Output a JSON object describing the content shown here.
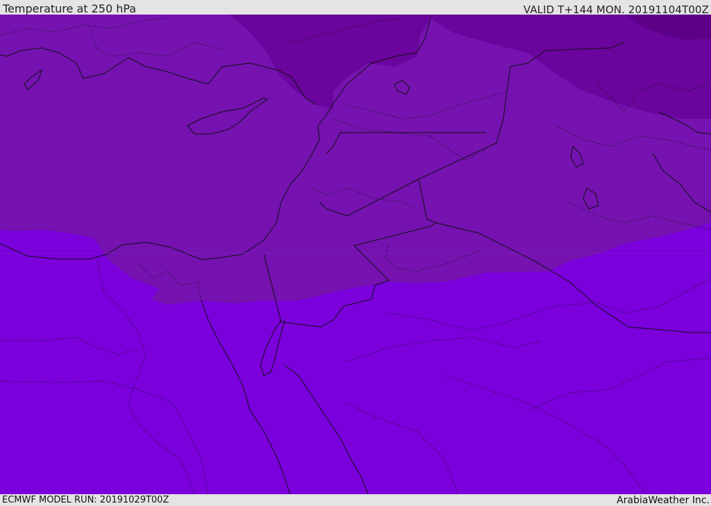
{
  "header": {
    "title": "Temperature at 250 hPa",
    "valid": "VALID T+144 MON. 20191104T00Z"
  },
  "footer": {
    "model_run": "ECMWF MODEL RUN: 20191029T00Z",
    "credit": "ArabiaWeather Inc."
  },
  "map": {
    "region": "Eastern Mediterranean / Middle East",
    "colors": {
      "warm_band": "#7a00dc",
      "mid_band": "#7512b0",
      "cool_band": "#69049c",
      "cold_band": "#5c0088",
      "borders": "#111111"
    }
  }
}
